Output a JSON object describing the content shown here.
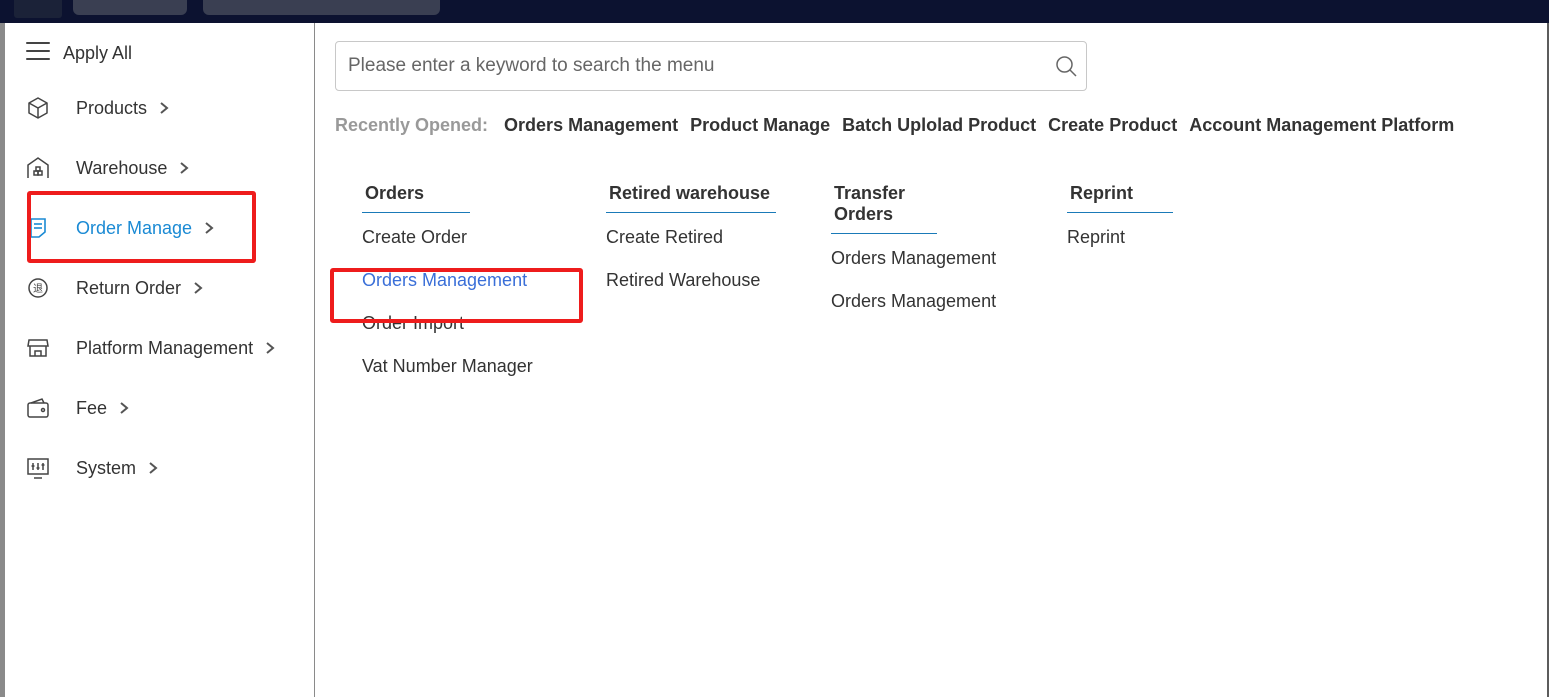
{
  "sidebar": {
    "apply_all": {
      "label": "Apply All",
      "icon": "hamburger-menu-icon"
    },
    "items": [
      {
        "label": "Products",
        "icon": "cube-icon",
        "active": false
      },
      {
        "label": "Warehouse",
        "icon": "warehouse-icon",
        "active": false
      },
      {
        "label": "Order Manage",
        "icon": "document-icon",
        "active": true
      },
      {
        "label": "Return Order",
        "icon": "return-icon",
        "active": false
      },
      {
        "label": "Platform Management",
        "icon": "store-icon",
        "active": false
      },
      {
        "label": "Fee",
        "icon": "wallet-icon",
        "active": false
      },
      {
        "label": "System",
        "icon": "monitor-settings-icon",
        "active": false
      }
    ]
  },
  "search": {
    "placeholder": "Please enter a keyword to search the menu",
    "icon": "search-icon"
  },
  "recent": {
    "label": "Recently Opened:",
    "items": [
      "Orders Management",
      "Product Manage",
      "Batch Uplolad Product",
      "Create Product",
      "Account Management Platform"
    ]
  },
  "columns": [
    {
      "heading": "Orders",
      "links": [
        "Create Order",
        "Orders Management",
        "Order Import",
        "Vat Number Manager"
      ]
    },
    {
      "heading": "Retired warehouse",
      "links": [
        "Create Retired",
        "Retired Warehouse"
      ]
    },
    {
      "heading": "Transfer Orders",
      "links": [
        "Orders Management",
        "Orders Management"
      ]
    },
    {
      "heading": "Reprint",
      "links": [
        "Reprint"
      ]
    }
  ],
  "colors": {
    "active_nav": "#1a8ad4",
    "active_link": "#3a6fd8",
    "highlight_box": "#ee1c1c",
    "topbar": "#0c1230"
  }
}
